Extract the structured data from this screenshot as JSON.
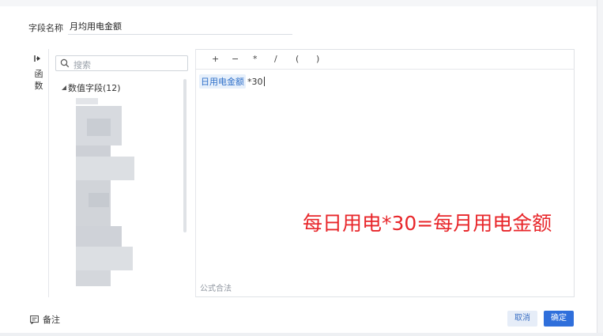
{
  "header": {
    "field_label": "字段名称",
    "field_value": "月均用电金额"
  },
  "function_panel": {
    "toggle_icon": "expand-right-icon",
    "label_line1": "函",
    "label_line2": "数"
  },
  "field_panel": {
    "search_placeholder": "搜索",
    "group_label": "数值字段(12)"
  },
  "operators": [
    "+",
    "−",
    "*",
    "/",
    "(",
    ")"
  ],
  "formula": {
    "token": "日用电金额",
    "rest": "*30"
  },
  "annotation": "每日用电*30=每月用电金额",
  "status": "公式合法",
  "footer": {
    "notes_label": "备注",
    "cancel_label": "取消",
    "ok_label": "确定"
  },
  "colors": {
    "accent": "#2f6fdb",
    "annotation": "#e8262a"
  }
}
